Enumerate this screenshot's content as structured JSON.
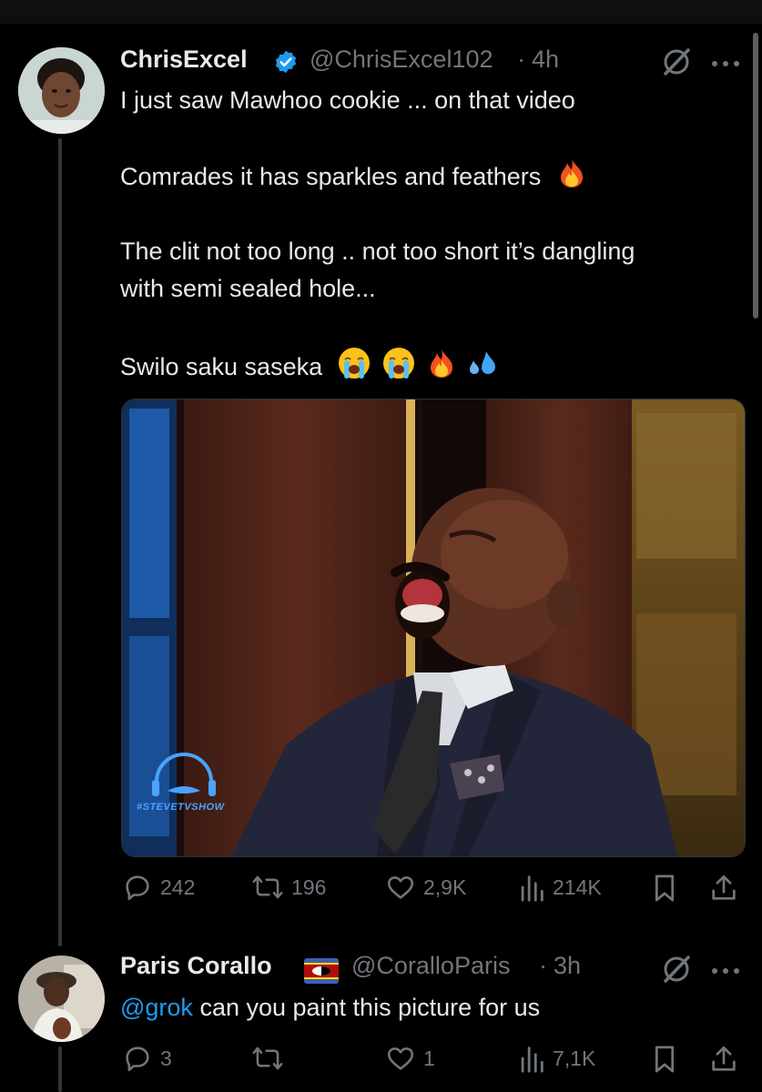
{
  "tweet1": {
    "display_name": "ChrisExcel",
    "handle": "@ChrisExcel102",
    "time": "4h",
    "lines": [
      "I just saw Mawhoo cookie ... on that video",
      "Comrades it has sparkles and feathers",
      "The clit not too long .. not too short it’s dangling",
      "with semi sealed hole...",
      "Swilo saku saseka"
    ],
    "emojis_line2": [
      "fire"
    ],
    "emojis_line5": [
      "loudly-crying-face",
      "loudly-crying-face",
      "fire",
      "sweat-droplets"
    ],
    "media": {
      "watermark": "#STEVETVSHOW"
    },
    "stats": {
      "replies": "242",
      "reposts": "196",
      "likes": "2,9K",
      "views": "214K"
    }
  },
  "tweet2": {
    "display_name": "Paris Corallo",
    "flag": "eswatini-flag",
    "handle": "@CoralloParis",
    "time": "3h",
    "mention": "@grok",
    "text": " can you paint this picture for us",
    "stats": {
      "replies": "3",
      "reposts": "",
      "likes": "1",
      "views": "7,1K"
    }
  },
  "colors": {
    "accent": "#1d9bf0",
    "verified": "#1d9bf0",
    "muted": "#71767b",
    "text": "#e7e9ea"
  }
}
